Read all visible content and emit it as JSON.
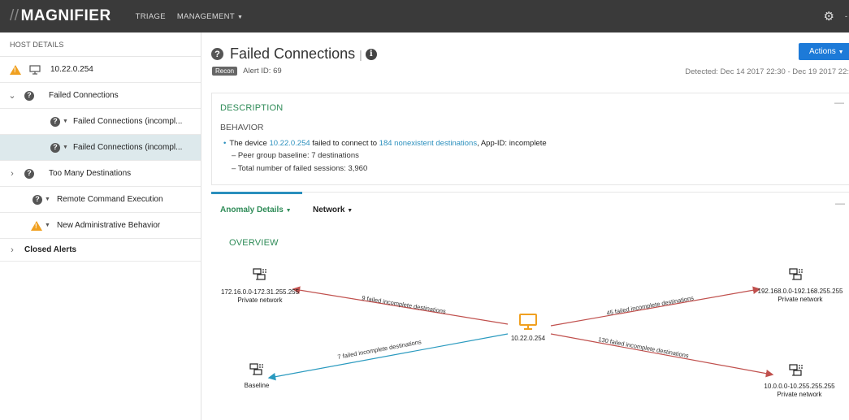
{
  "nav": {
    "logo": "MAGNIFIER",
    "items": [
      {
        "label": "TRIAGE"
      },
      {
        "label": "MANAGEMENT"
      }
    ]
  },
  "sidebar": {
    "header": "HOST DETAILS",
    "host": "10.22.0.254",
    "items": [
      {
        "label": "Failed Connections"
      },
      {
        "label": "Failed Connections (incompl..."
      },
      {
        "label": "Failed Connections (incompl..."
      },
      {
        "label": "Too Many Destinations"
      },
      {
        "label": "Remote Command Execution"
      },
      {
        "label": "New Administrative Behavior"
      },
      {
        "label": "Closed Alerts"
      }
    ]
  },
  "main": {
    "title": "Failed Connections",
    "actions_label": "Actions",
    "badge": "Recon",
    "alert_id": "Alert ID: 69",
    "detected": "Detected: Dec 14 2017 22:30 - Dec 19 2017 22:",
    "description": {
      "title": "DESCRIPTION",
      "behavior": "BEHAVIOR",
      "bullet_prefix": "The device",
      "device": "10.22.0.254",
      "bullet_mid": "failed to connect to",
      "destinations_link": "184 nonexistent destinations",
      "bullet_suffix": ", App-ID: incomplete",
      "sublines": [
        "– Peer group baseline: 7 destinations",
        "– Total number of failed sessions: 3,960"
      ]
    },
    "tabs": [
      {
        "label": "Anomaly Details"
      },
      {
        "label": "Network"
      }
    ],
    "overview": "OVERVIEW"
  },
  "graph": {
    "center": {
      "label": "10.22.0.254"
    },
    "nodes": [
      {
        "id": "n1",
        "line1": "172.16.0.0-172.31.255.255",
        "line2": "Private network"
      },
      {
        "id": "n2",
        "line1": "192.168.0.0-192.168.255.255",
        "line2": "Private network"
      },
      {
        "id": "n3",
        "line1": "Baseline",
        "line2": ""
      },
      {
        "id": "n4",
        "line1": "10.0.0.0-10.255.255.255",
        "line2": "Private network"
      }
    ],
    "edges": [
      {
        "to": "n1",
        "label": "9 failed incomplete destinations",
        "color": "#c0504d"
      },
      {
        "to": "n2",
        "label": "45 failed incomplete destinations",
        "color": "#c0504d"
      },
      {
        "to": "n3",
        "label": "7 failed incomplete destinations",
        "color": "#2a9abf"
      },
      {
        "to": "n4",
        "label": "130 failed incomplete destinations",
        "color": "#c0504d"
      }
    ]
  },
  "colors": {
    "topbar": "#3a3a3a",
    "accent_blue": "#1d7ad8",
    "link": "#2a8fbd",
    "heading_green": "#2e8b57",
    "warning": "#f0a020",
    "selected_row": "#dde9ec",
    "center_node": "#f0a020"
  }
}
